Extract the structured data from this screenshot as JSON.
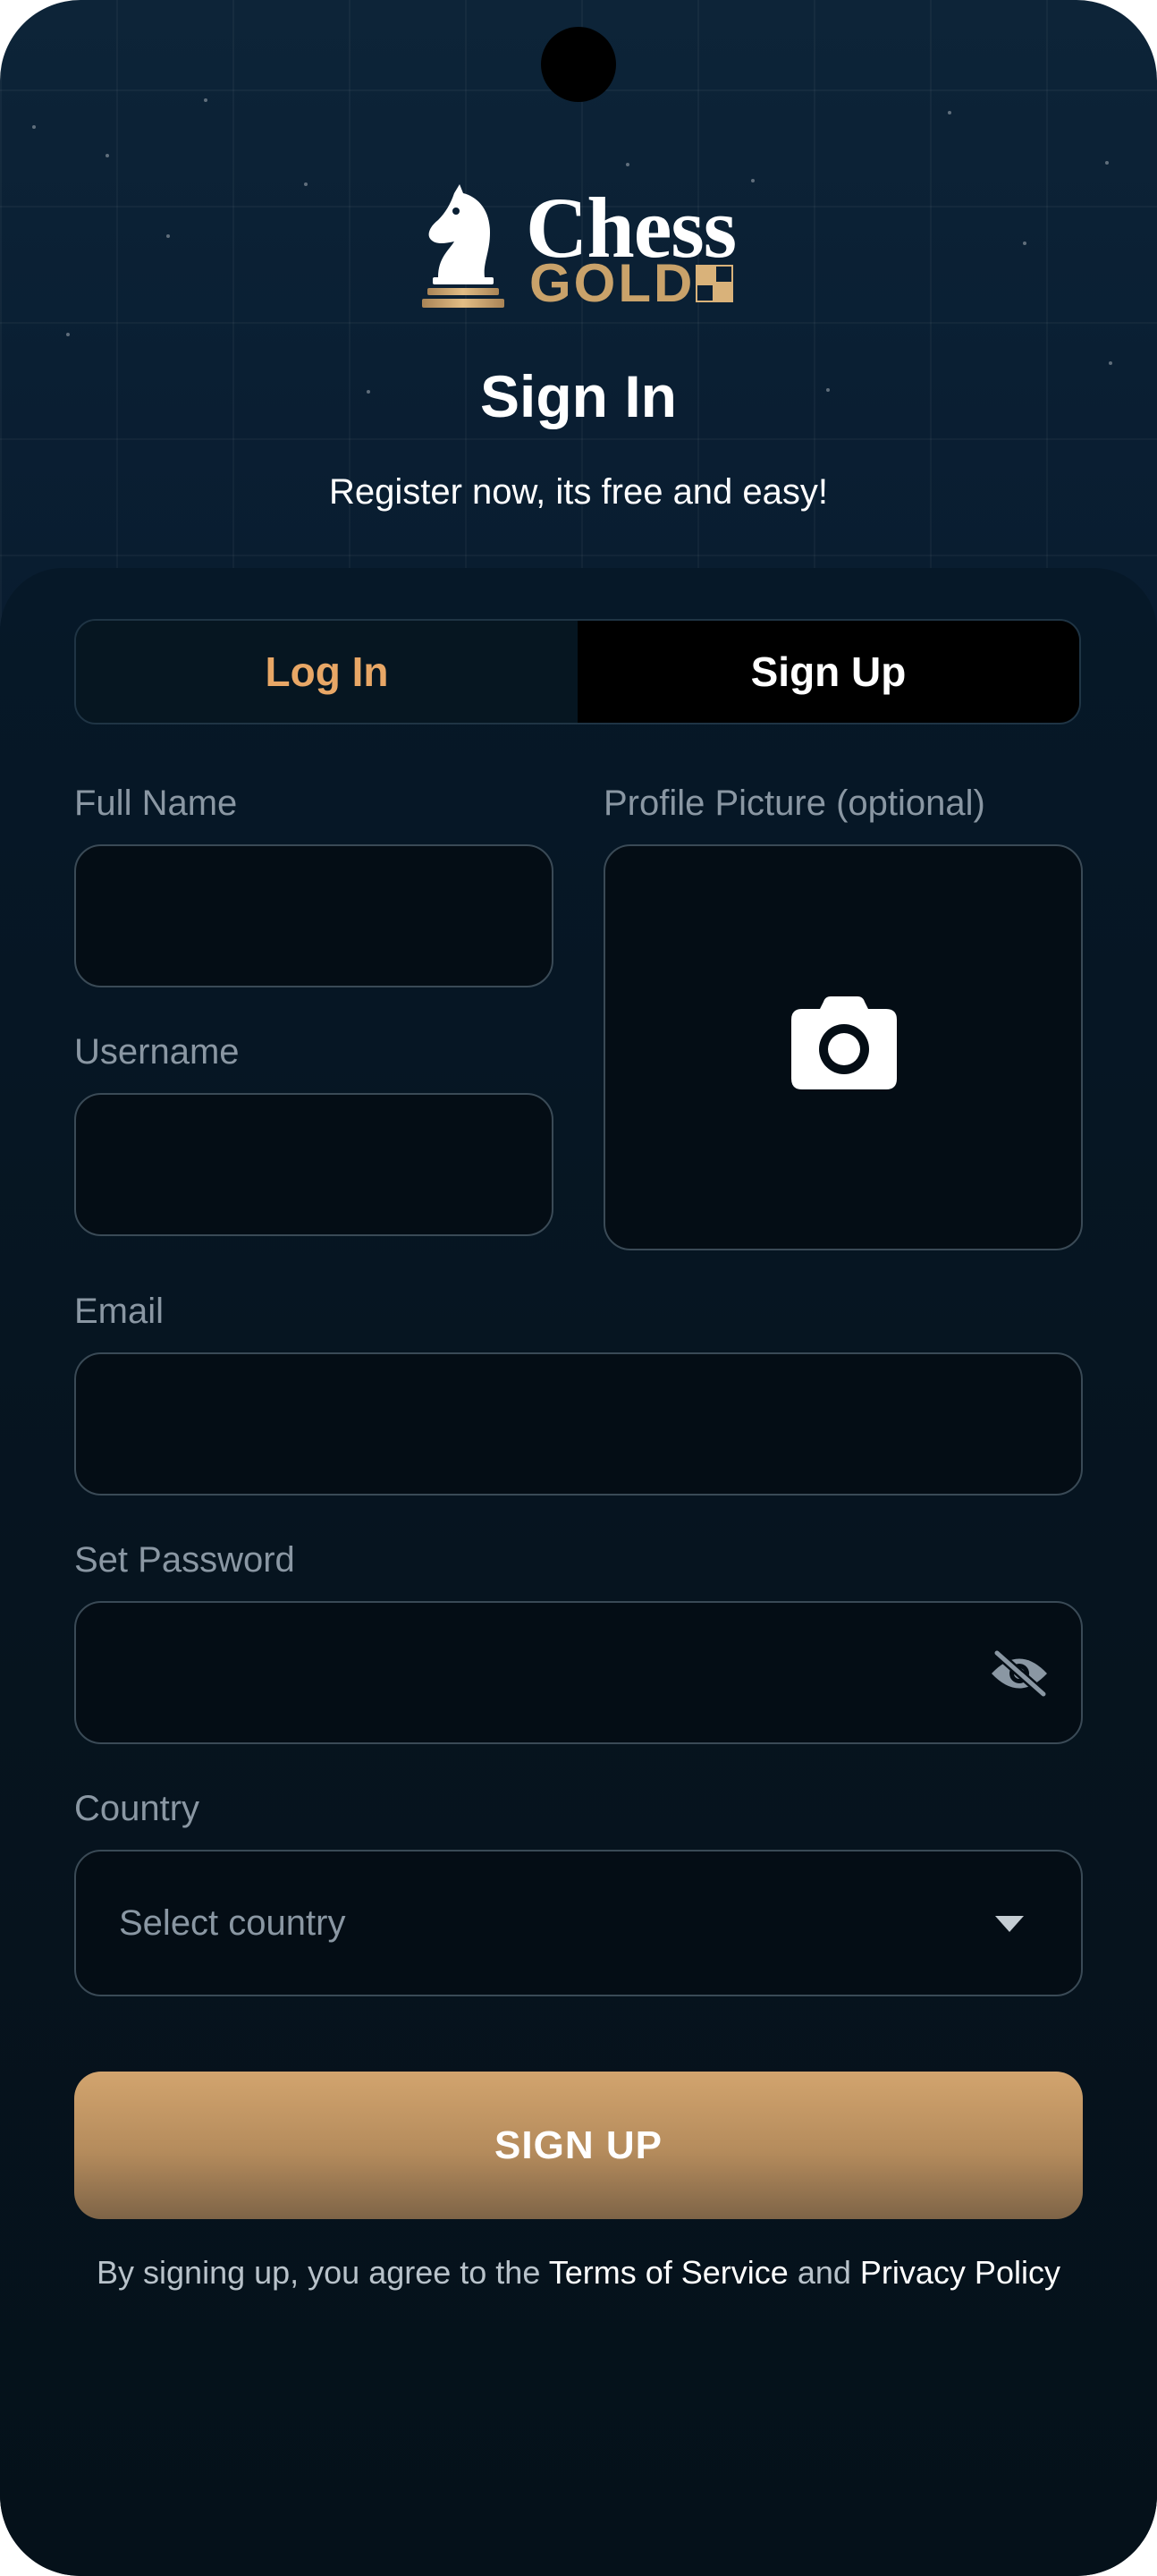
{
  "header": {
    "logo_word_top": "Chess",
    "logo_word_bottom": "GOLD",
    "title": "Sign In",
    "subtitle": "Register now, its free and easy!"
  },
  "tabs": [
    {
      "label": "Log In",
      "active": false
    },
    {
      "label": "Sign Up",
      "active": true
    }
  ],
  "form": {
    "full_name": {
      "label": "Full Name",
      "value": ""
    },
    "profile_picture": {
      "label": "Profile Picture (optional)",
      "icon": "camera-icon"
    },
    "username": {
      "label": "Username",
      "value": ""
    },
    "email": {
      "label": "Email",
      "value": ""
    },
    "password": {
      "label": "Set Password",
      "value": "",
      "toggle_icon": "eye-off-icon"
    },
    "country": {
      "label": "Country",
      "placeholder": "Select country",
      "icon": "chevron-down-icon"
    }
  },
  "submit_label": "SIGN UP",
  "legal": {
    "prefix": "By signing up, you agree to the",
    "terms": "Terms of Service",
    "and": "and",
    "privacy": "Privacy Policy"
  },
  "colors": {
    "accent_gold": "#c9a26a",
    "tab_active_text": "#e8a766",
    "background": "#07182a"
  }
}
